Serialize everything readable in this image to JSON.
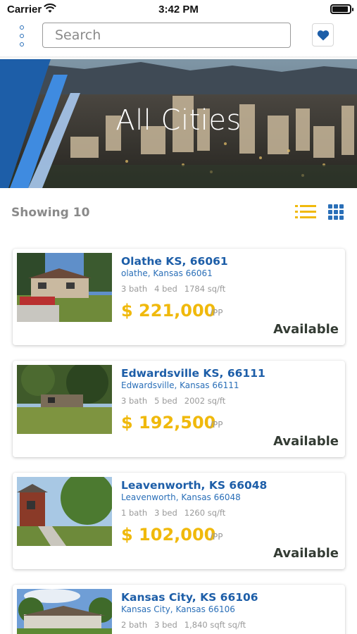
{
  "status_bar": {
    "carrier": "Carrier",
    "time": "3:42 PM"
  },
  "search": {
    "placeholder": "Search",
    "value": ""
  },
  "hero": {
    "title": "All Cities"
  },
  "results": {
    "showing": "Showing 10"
  },
  "colors": {
    "brand_blue": "#1d5ea8",
    "price_yellow": "#f0b90c",
    "accent_yellow": "#f0b90c"
  },
  "listings": [
    {
      "name": "Olathe KS, 66061",
      "address": "olathe, Kansas 66061",
      "bath": "3 bath",
      "bed": "4 bed",
      "area": "1784 sq/ft",
      "price": "$ 221,000",
      "unit": "/PP",
      "status": "Available"
    },
    {
      "name": "Edwardsville KS, 66111",
      "address": "Edwardsville, Kansas 66111",
      "bath": "3 bath",
      "bed": "5 bed",
      "area": "2002 sq/ft",
      "price": "$ 192,500",
      "unit": "/PP",
      "status": "Available"
    },
    {
      "name": "Leavenworth, KS 66048",
      "address": "Leavenworth, Kansas 66048",
      "bath": "1 bath",
      "bed": "3 bed",
      "area": "1260 sq/ft",
      "price": "$ 102,000",
      "unit": "/PP",
      "status": "Available"
    },
    {
      "name": "Kansas City, KS 66106",
      "address": "Kansas City, Kansas 66106",
      "bath": "2 bath",
      "bed": "3 bed",
      "area": "1,840 sqft sq/ft",
      "price": "",
      "unit": "",
      "status": ""
    }
  ]
}
